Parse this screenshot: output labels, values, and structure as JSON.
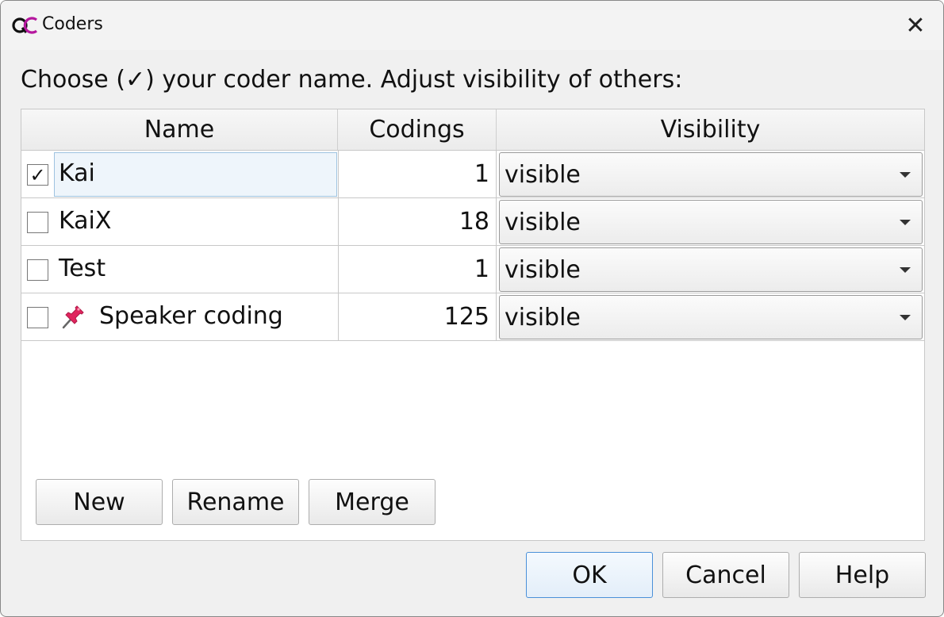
{
  "window": {
    "title": "Coders",
    "close_glyph": "✕",
    "icon": "qualcoder-app-icon"
  },
  "prompt": "Choose (✓) your coder name. Adjust visibility of others:",
  "table": {
    "headers": {
      "name": "Name",
      "codings": "Codings",
      "visibility": "Visibility"
    },
    "rows": [
      {
        "checked": "✓",
        "name": "Kai",
        "codings": "1",
        "visibility": "visible",
        "pinned": false
      },
      {
        "checked": "",
        "name": "KaiX",
        "codings": "18",
        "visibility": "visible",
        "pinned": false
      },
      {
        "checked": "",
        "name": "Test",
        "codings": "1",
        "visibility": "visible",
        "pinned": false
      },
      {
        "checked": "",
        "name": "Speaker coding",
        "codings": "125",
        "visibility": "visible",
        "pinned": true
      }
    ]
  },
  "panel_buttons": {
    "new": "New",
    "rename": "Rename",
    "merge": "Merge"
  },
  "dialog_buttons": {
    "ok": "OK",
    "cancel": "Cancel",
    "help": "Help"
  },
  "colors": {
    "selection_bg": "#eef5fb",
    "selection_border": "#9ec3e0",
    "default_button_border": "#4a90d9"
  }
}
